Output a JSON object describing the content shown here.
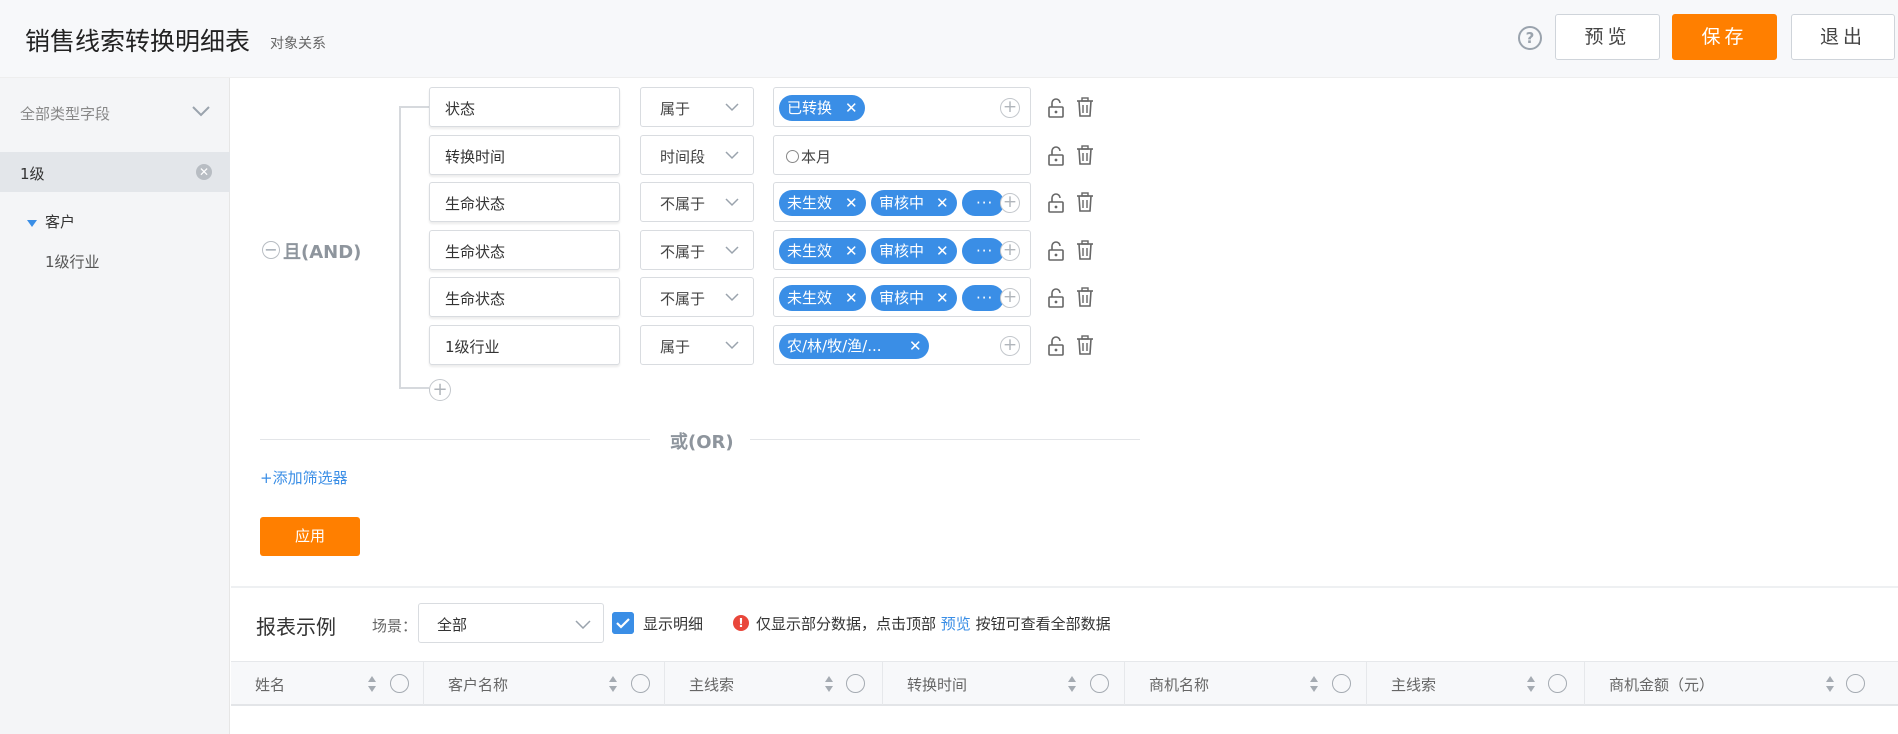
{
  "header": {
    "title": "销售线索转换明细表",
    "subtitle": "对象关系",
    "help_icon": "?",
    "preview_label": "预览",
    "save_label": "保存",
    "exit_label": "退出",
    "accent_color": "#ff7f00"
  },
  "sidebar": {
    "filter_placeholder": "全部类型字段",
    "selected_label": "1级",
    "tree": {
      "node": "客户",
      "child": "1级行业"
    }
  },
  "filters": {
    "group_label": "且(AND)",
    "or_label": "或(OR)",
    "add_filter_label": "+添加筛选器",
    "apply_label": "应用",
    "rows": [
      {
        "field": "状态",
        "operator": "属于",
        "tags": [
          "已转换"
        ]
      },
      {
        "field": "转换时间",
        "operator": "时间段",
        "value": "本月"
      },
      {
        "field": "生命状态",
        "operator": "不属于",
        "tags": [
          "未生效",
          "审核中"
        ],
        "more": "···"
      },
      {
        "field": "生命状态",
        "operator": "不属于",
        "tags": [
          "未生效",
          "审核中"
        ],
        "more": "···"
      },
      {
        "field": "生命状态",
        "operator": "不属于",
        "tags": [
          "未生效",
          "审核中"
        ],
        "more": "···"
      },
      {
        "field": "1级行业",
        "operator": "属于",
        "tags": [
          "农/林/牧/渔/..."
        ]
      }
    ],
    "tag_color": "#3a8ee6"
  },
  "report": {
    "title": "报表示例",
    "scene_label": "场景：",
    "scene_value": "全部",
    "show_detail_label": "显示明细",
    "note_prefix": "仅显示部分数据，点击顶部",
    "note_link": "预览",
    "note_suffix": "按钮可查看全部数据",
    "columns": [
      "姓名",
      "客户名称",
      "主线索",
      "转换时间",
      "商机名称",
      "主线索",
      "商机金额（元）"
    ]
  }
}
